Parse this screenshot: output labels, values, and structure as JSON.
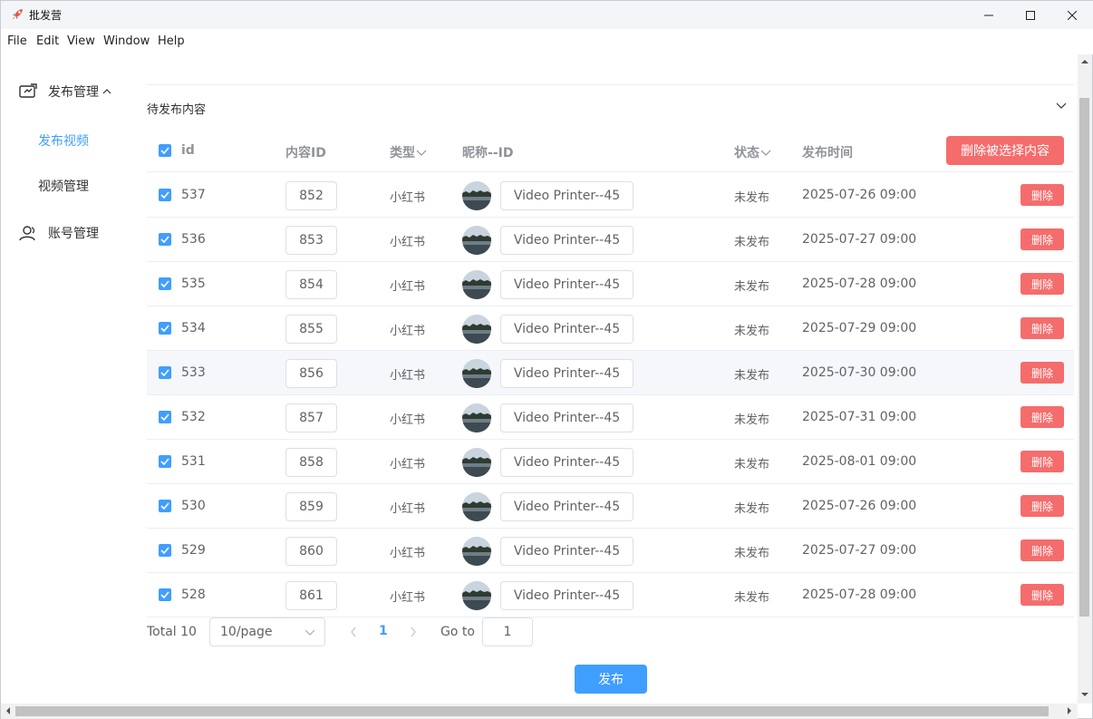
{
  "window": {
    "title": "批发营"
  },
  "menu": [
    "File",
    "Edit",
    "View",
    "Window",
    "Help"
  ],
  "sidebar": {
    "group1": {
      "label": "发布管理",
      "icon": "publish-manage-icon",
      "expanded": true
    },
    "sub_items": [
      {
        "label": "发布视频",
        "active": true
      },
      {
        "label": "视频管理",
        "active": false
      }
    ],
    "group2": {
      "label": "账号管理",
      "icon": "user-icon"
    }
  },
  "section": {
    "title": "待发布内容"
  },
  "table": {
    "headers": {
      "id": "id",
      "content_id": "内容ID",
      "type": "类型",
      "nickname": "昵称--ID",
      "status": "状态",
      "time": "发布时间"
    },
    "delete_selected_label": "删除被选择内容",
    "rows": [
      {
        "id": "537",
        "content_id": "852",
        "type": "小红书",
        "nickname": "Video Printer--45",
        "status": "未发布",
        "time": "2025-07-26 09:00",
        "delete": "删除"
      },
      {
        "id": "536",
        "content_id": "853",
        "type": "小红书",
        "nickname": "Video Printer--45",
        "status": "未发布",
        "time": "2025-07-27 09:00",
        "delete": "删除"
      },
      {
        "id": "535",
        "content_id": "854",
        "type": "小红书",
        "nickname": "Video Printer--45",
        "status": "未发布",
        "time": "2025-07-28 09:00",
        "delete": "删除"
      },
      {
        "id": "534",
        "content_id": "855",
        "type": "小红书",
        "nickname": "Video Printer--45",
        "status": "未发布",
        "time": "2025-07-29 09:00",
        "delete": "删除"
      },
      {
        "id": "533",
        "content_id": "856",
        "type": "小红书",
        "nickname": "Video Printer--45",
        "status": "未发布",
        "time": "2025-07-30 09:00",
        "delete": "删除"
      },
      {
        "id": "532",
        "content_id": "857",
        "type": "小红书",
        "nickname": "Video Printer--45",
        "status": "未发布",
        "time": "2025-07-31 09:00",
        "delete": "删除"
      },
      {
        "id": "531",
        "content_id": "858",
        "type": "小红书",
        "nickname": "Video Printer--45",
        "status": "未发布",
        "time": "2025-08-01 09:00",
        "delete": "删除"
      },
      {
        "id": "530",
        "content_id": "859",
        "type": "小红书",
        "nickname": "Video Printer--45",
        "status": "未发布",
        "time": "2025-07-26 09:00",
        "delete": "删除"
      },
      {
        "id": "529",
        "content_id": "860",
        "type": "小红书",
        "nickname": "Video Printer--45",
        "status": "未发布",
        "time": "2025-07-27 09:00",
        "delete": "删除"
      },
      {
        "id": "528",
        "content_id": "861",
        "type": "小红书",
        "nickname": "Video Printer--45",
        "status": "未发布",
        "time": "2025-07-28 09:00",
        "delete": "删除"
      }
    ]
  },
  "pagination": {
    "total": "Total 10",
    "page_size": "10/page",
    "current_page": "1",
    "goto_label": "Go to",
    "goto_value": "1"
  },
  "publish_button": "发布",
  "colors": {
    "primary": "#409eff",
    "danger": "#f56c6c",
    "text": "#606266",
    "header_text": "#909399"
  }
}
